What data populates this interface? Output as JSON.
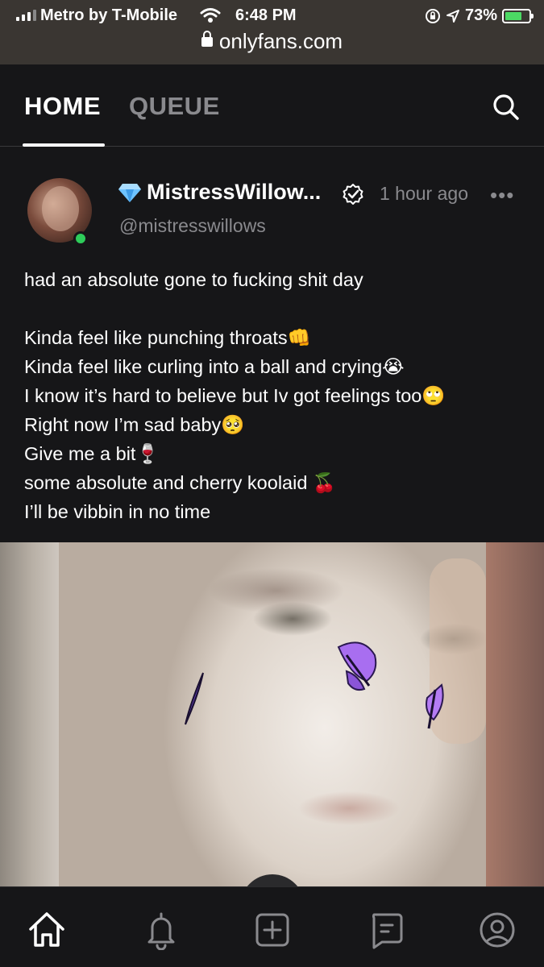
{
  "status_bar": {
    "carrier": "Metro by T-Mobile",
    "time": "6:48 PM",
    "battery": "73%",
    "battery_level": 0.73,
    "url": "onlyfans.com"
  },
  "nav": {
    "home_label": "HOME",
    "queue_label": "QUEUE",
    "active_tab": "HOME"
  },
  "post": {
    "display_name": "MistressWillow...",
    "name_badge_icon": "diamond-icon",
    "handle": "@mistresswillows",
    "time_ago": "1 hour ago",
    "more_label": "•••",
    "verified": true,
    "online": true,
    "text_lines": [
      "had an absolute gone to fucking shit day",
      "",
      "Kinda feel like punching throats👊",
      "Kinda feel like curling into a ball and crying😭",
      "I know it’s hard to believe but Iv got feelings too🙄",
      "Right now I’m sad baby🥺",
      "Give me a bit🍷",
      "some absolute and cherry koolaid 🍒",
      "I’ll be vibbin in no time"
    ]
  },
  "bottom_nav": {
    "items": [
      "home-icon",
      "bell-icon",
      "add-post-icon",
      "messages-icon",
      "profile-icon"
    ]
  },
  "colors": {
    "background": "#161618",
    "muted_text": "#8a8a8e",
    "online": "#2ecc5a",
    "butterfly": "#b070f0"
  }
}
